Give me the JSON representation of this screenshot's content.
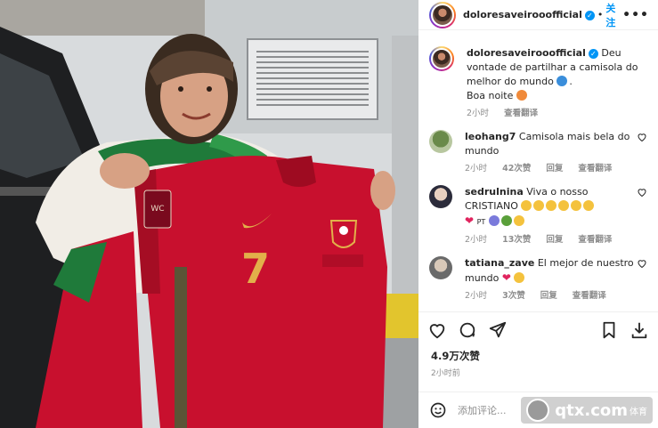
{
  "header": {
    "username": "doloresaveirooofficial",
    "separator": "•",
    "follow_label": "关注",
    "more_label": "•••"
  },
  "caption": {
    "username": "doloresaveirooofficial",
    "text_line1": "Deu vontade de partilhar a camisola do melhor do mundo",
    "text_line2": "Boa noite",
    "time": "2小时",
    "translate": "查看翻译"
  },
  "comments": [
    {
      "username": "leohang7",
      "text": "Camisola mais bela do mundo",
      "time": "2小时",
      "likes": "42次赞",
      "reply": "回复",
      "translate": "查看翻译"
    },
    {
      "username": "sedrulnina",
      "text_line1": "Viva o nosso CRISTIANO",
      "tag": "PT",
      "time": "2小时",
      "likes": "13次赞",
      "reply": "回复",
      "translate": "查看翻译"
    },
    {
      "username": "tatiana_zave",
      "text": "El mejor de nuestro mundo",
      "time": "2小时",
      "likes": "3次赞",
      "reply": "回复",
      "translate": "查看翻译"
    }
  ],
  "post": {
    "likes": "4.9万次赞",
    "time": "2小时前"
  },
  "add_comment": {
    "placeholder": "添加评论..."
  },
  "watermark": {
    "site": "qtx.com",
    "tag": "体育"
  },
  "photo": {
    "jersey_number": "7"
  },
  "colors": {
    "accent": "#0095f6",
    "jersey_red": "#c8102e",
    "heart_red": "#e0245e"
  }
}
